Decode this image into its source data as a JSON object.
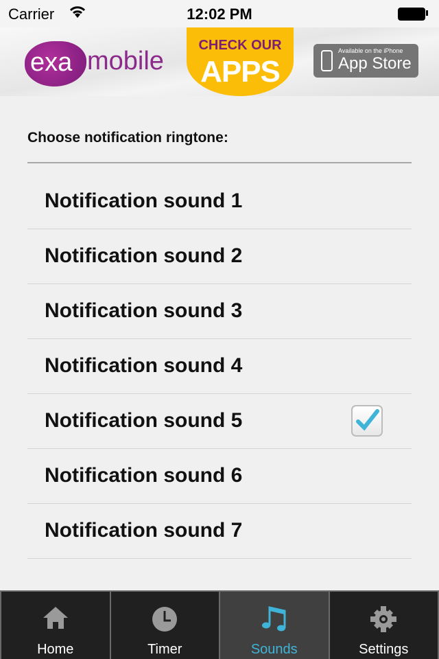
{
  "status_bar": {
    "carrier": "Carrier",
    "time": "12:02 PM"
  },
  "banner": {
    "logo_exa": "exa",
    "logo_mobile": "mobile",
    "check_our": "CHECK OUR",
    "apps": "APPS",
    "store_available": "Available on the iPhone",
    "store_name": "App Store"
  },
  "section_title": "Choose notification ringtone:",
  "sounds": [
    {
      "label": "Notification sound 1",
      "selected": false
    },
    {
      "label": "Notification sound 2",
      "selected": false
    },
    {
      "label": "Notification sound 3",
      "selected": false
    },
    {
      "label": "Notification sound 4",
      "selected": false
    },
    {
      "label": "Notification sound 5",
      "selected": true
    },
    {
      "label": "Notification sound 6",
      "selected": false
    },
    {
      "label": "Notification sound 7",
      "selected": false
    }
  ],
  "tabs": [
    {
      "label": "Home",
      "icon": "home-icon"
    },
    {
      "label": "Timer",
      "icon": "clock-icon"
    },
    {
      "label": "Sounds",
      "icon": "music-note-icon",
      "active": true
    },
    {
      "label": "Settings",
      "icon": "gear-icon"
    }
  ],
  "colors": {
    "accent": "#3fb4d8",
    "apps_yellow": "#fbbd08",
    "brand_purple": "#8b2a8b"
  }
}
